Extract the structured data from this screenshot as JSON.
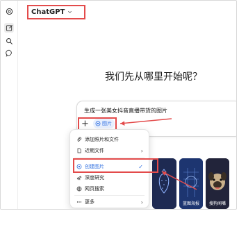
{
  "app": {
    "model_name": "ChatGPT"
  },
  "sidebar": {
    "items": [
      {
        "icon": "openai-logo-icon"
      },
      {
        "icon": "new-chat-icon"
      },
      {
        "icon": "search-icon"
      },
      {
        "icon": "chat-bubble-icon"
      }
    ]
  },
  "main": {
    "headline": "我们先从哪里开始呢？"
  },
  "composer": {
    "text": "生成一张美女抖音直播带货的图片",
    "plus_label": "+",
    "chip_label": "图片"
  },
  "menu": {
    "items": [
      {
        "label": "添加照片和文件",
        "icon": "paperclip-icon"
      },
      {
        "label": "近期文件",
        "icon": "document-icon",
        "has_submenu": true
      },
      {
        "label": "创建图片",
        "icon": "image-create-icon",
        "selected": true
      },
      {
        "label": "深度研究",
        "icon": "telescope-icon"
      },
      {
        "label": "网页搜索",
        "icon": "globe-icon"
      },
      {
        "label": "更多",
        "icon": "more-icon",
        "has_submenu": true
      }
    ],
    "submenu_glyph": "›",
    "check_glyph": "✓"
  },
  "gallery": {
    "thumbnails": [
      {
        "label": ""
      },
      {
        "label": "蓝图海报"
      },
      {
        "label": "搜狗闻嘴"
      }
    ]
  },
  "colors": {
    "highlight": "#e34b4b",
    "chip_bg": "#e8f0fe",
    "chip_text": "#2f6fe0"
  }
}
